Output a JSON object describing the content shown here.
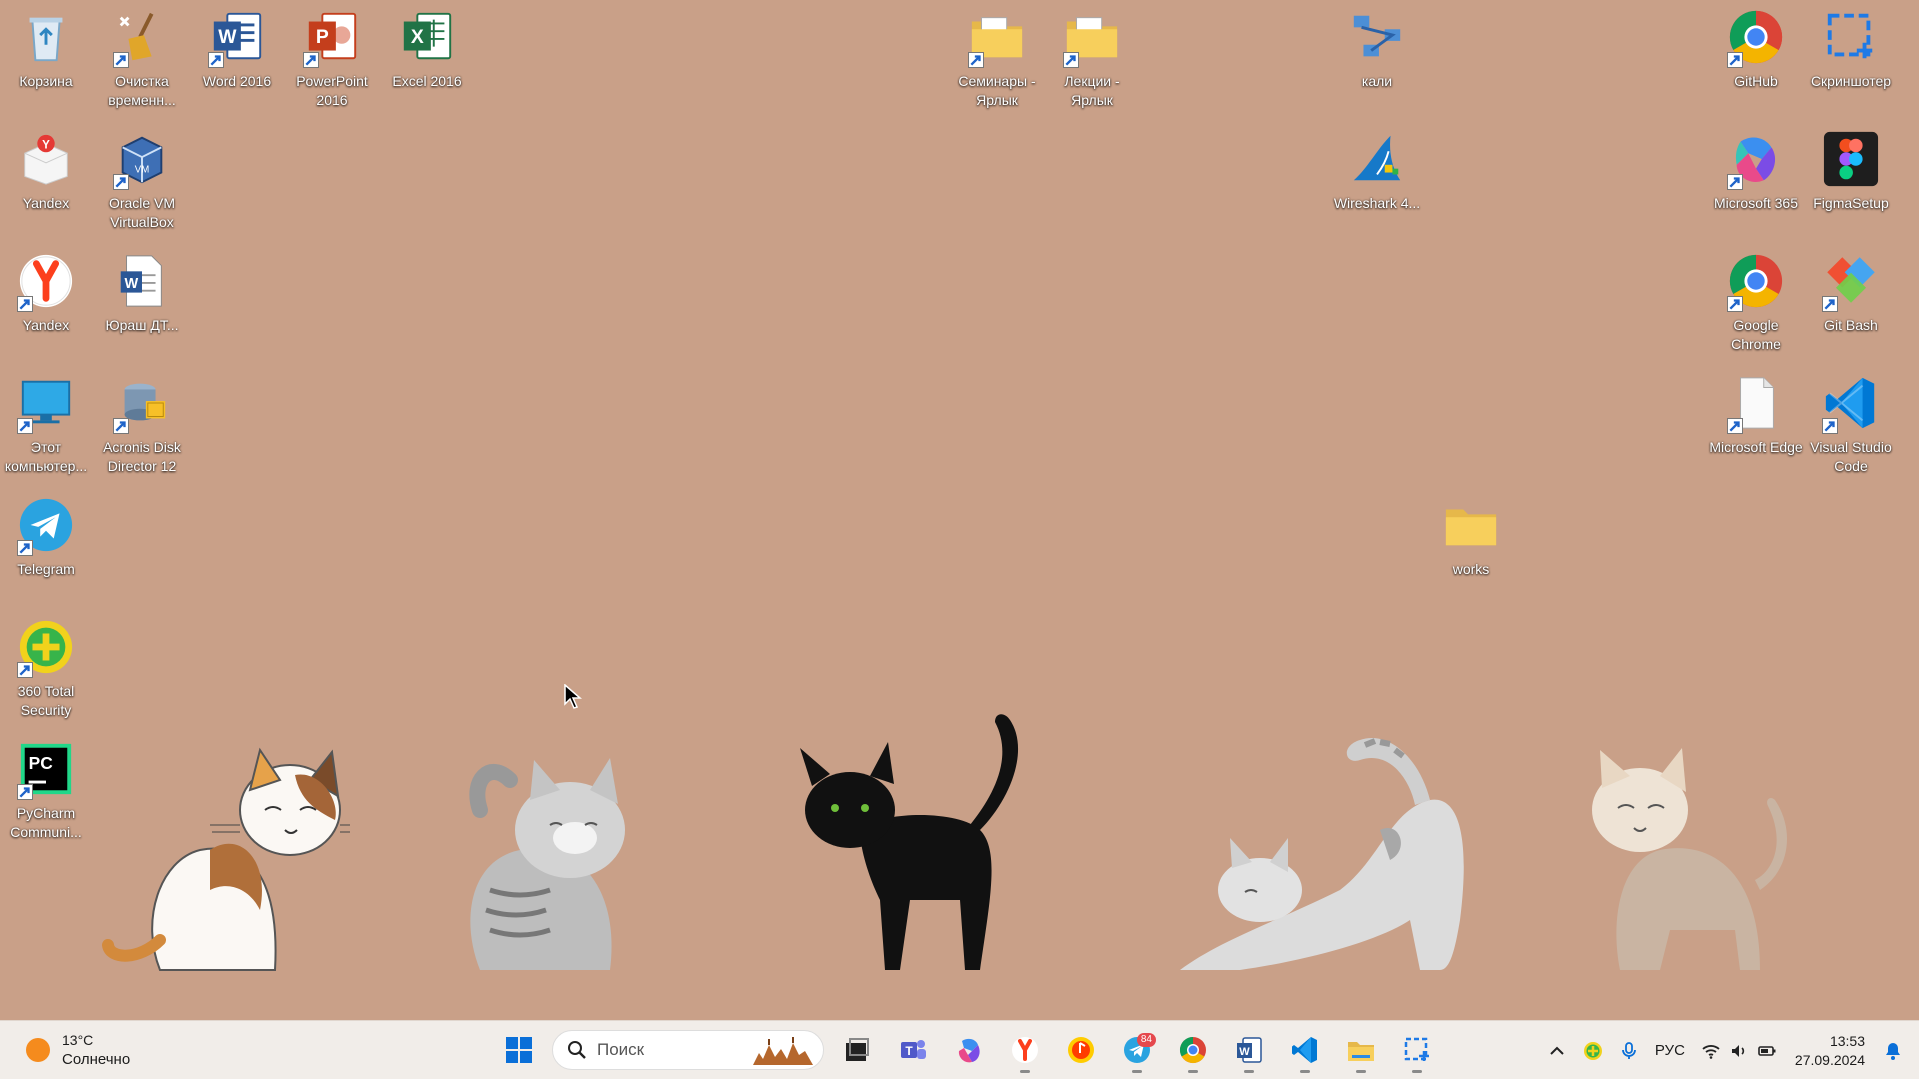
{
  "desktop": {
    "icons": [
      {
        "label": "Корзина",
        "icon": "recycle-bin-icon"
      },
      {
        "label": "Очистка временн...",
        "icon": "broom-icon"
      },
      {
        "label": "Word 2016",
        "icon": "word-icon"
      },
      {
        "label": "PowerPoint 2016",
        "icon": "powerpoint-icon"
      },
      {
        "label": "Excel 2016",
        "icon": "excel-icon"
      },
      {
        "label": "Семинары - Ярлык",
        "icon": "folder-icon"
      },
      {
        "label": "Лекции - Ярлык",
        "icon": "folder-icon"
      },
      {
        "label": "кали",
        "icon": "network-icon"
      },
      {
        "label": "GitHub",
        "icon": "chrome-icon"
      },
      {
        "label": "Скриншотер",
        "icon": "screenshot-icon"
      },
      {
        "label": "Yandex",
        "icon": "yandex-box-icon"
      },
      {
        "label": "Oracle VM VirtualBox",
        "icon": "virtualbox-icon"
      },
      {
        "label": "Wireshark 4...",
        "icon": "wireshark-icon"
      },
      {
        "label": "Microsoft 365",
        "icon": "m365-icon"
      },
      {
        "label": "FigmaSetup",
        "icon": "figma-icon"
      },
      {
        "label": "Yandex",
        "icon": "yandex-icon"
      },
      {
        "label": "Юраш ДТ...",
        "icon": "word-doc-icon"
      },
      {
        "label": "Google Chrome",
        "icon": "chrome-icon"
      },
      {
        "label": "Git Bash",
        "icon": "git-icon"
      },
      {
        "label": "Этот компьютер...",
        "icon": "monitor-icon"
      },
      {
        "label": "Acronis Disk Director 12",
        "icon": "acronis-icon"
      },
      {
        "label": "Microsoft Edge",
        "icon": "blank-file-icon"
      },
      {
        "label": "Visual Studio Code",
        "icon": "vscode-icon"
      },
      {
        "label": "Telegram",
        "icon": "telegram-icon"
      },
      {
        "label": "works",
        "icon": "folder-icon"
      },
      {
        "label": "360 Total Security",
        "icon": "security-icon"
      },
      {
        "label": "PyCharm Communi...",
        "icon": "pycharm-icon"
      }
    ]
  },
  "taskbar": {
    "weather": {
      "temp": "13°C",
      "condition": "Солнечно"
    },
    "search": {
      "placeholder": "Поиск"
    },
    "telegram_badge": "84",
    "tray": {
      "language": "РУС"
    },
    "clock": {
      "time": "13:53",
      "date": "27.09.2024"
    }
  },
  "colors": {
    "desktop_bg": "#c9a088",
    "taskbar_bg": "#f1ede9",
    "win_blue": "#0a6fd8"
  }
}
